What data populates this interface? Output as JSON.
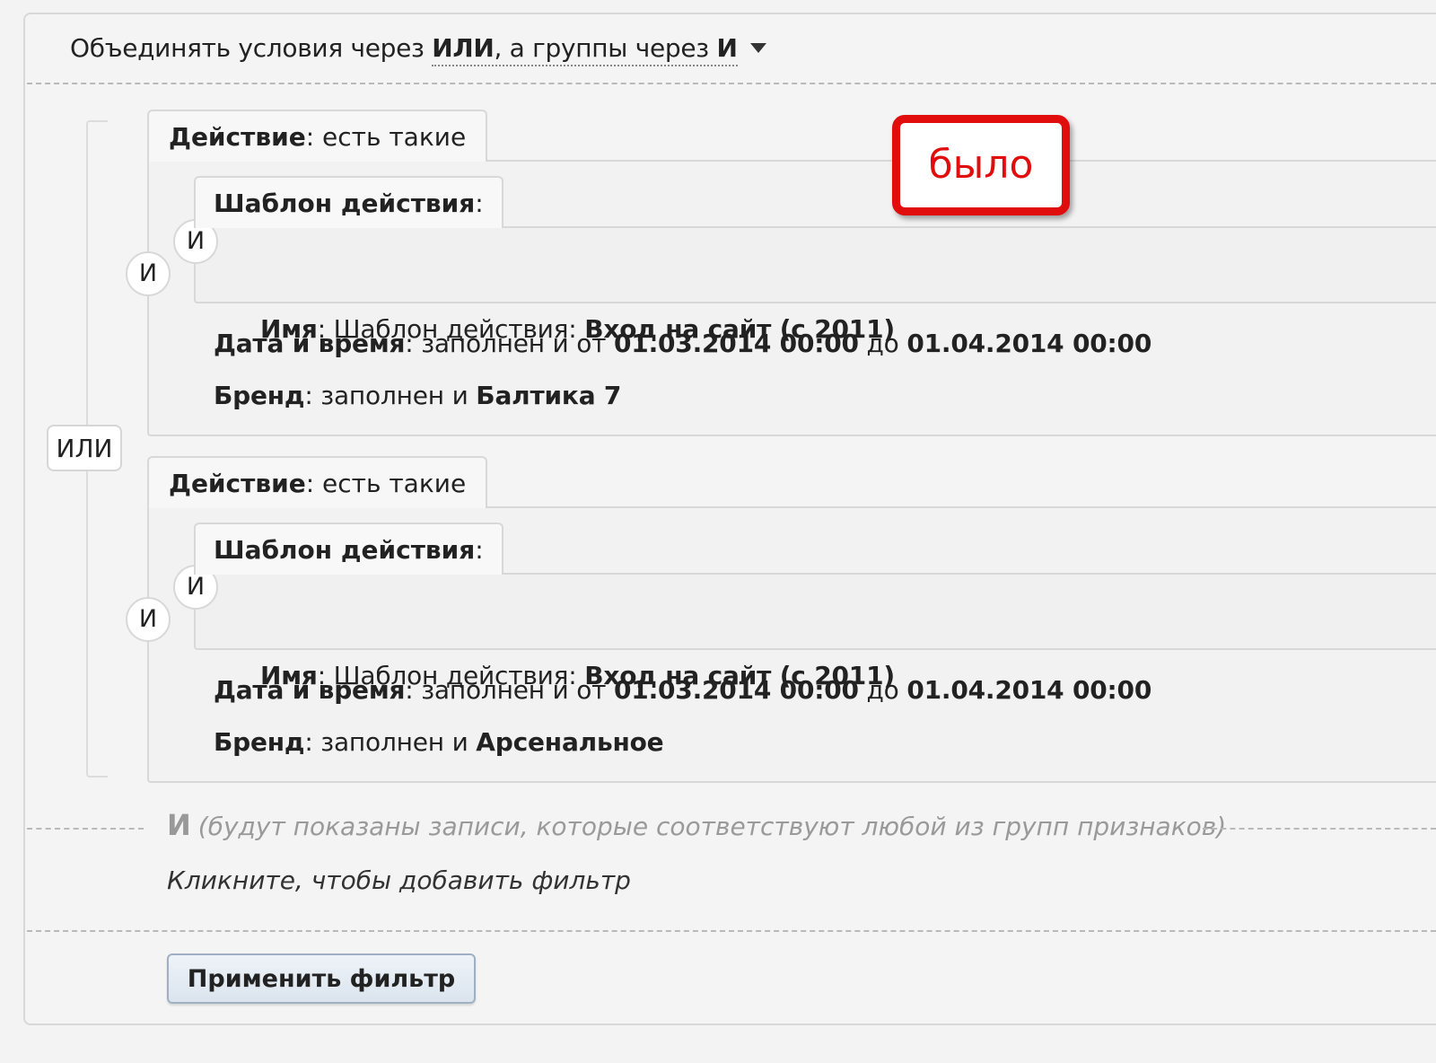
{
  "header": {
    "prefix": "Объединять условия через ",
    "conditions_op": "ИЛИ",
    "middle": ", а группы через ",
    "groups_op": "И",
    "dropdown_icon": "caret-down-icon"
  },
  "connectors": {
    "outer_or": "ИЛИ",
    "and": "И"
  },
  "groups": [
    {
      "action_label": "Действие",
      "action_value": ": есть такие",
      "template_label": "Шаблон действия",
      "template_colon": ":",
      "name_label": "Имя",
      "name_middle": ": Шаблон действия: ",
      "name_value": "Вход на сайт (с 2011)",
      "datetime_label": "Дата и время",
      "datetime_middle": ": заполнен и от ",
      "datetime_from": "01.03.2014 00:00",
      "datetime_to_word": " до ",
      "datetime_to": "01.04.2014 00:00",
      "brand_label": "Бренд",
      "brand_middle": ": заполнен и ",
      "brand_value": "Балтика 7"
    },
    {
      "action_label": "Действие",
      "action_value": ": есть такие",
      "template_label": "Шаблон действия",
      "template_colon": ":",
      "name_label": "Имя",
      "name_middle": ": Шаблон действия: ",
      "name_value": "Вход на сайт (с 2011)",
      "datetime_label": "Дата и время",
      "datetime_middle": ": заполнен и от ",
      "datetime_from": "01.03.2014 00:00",
      "datetime_to_word": " до ",
      "datetime_to": "01.04.2014 00:00",
      "brand_label": "Бренд",
      "brand_middle": ": заполнен и ",
      "brand_value": "Арсенальное"
    }
  ],
  "stamp": {
    "text": "было",
    "color": "#e10c0c"
  },
  "footer": {
    "and_label": "И",
    "and_note": "(будут показаны записи, которые соответствуют любой из групп признаков)",
    "add_filter": "Кликните, чтобы добавить фильтр",
    "apply_button": "Применить фильтр"
  }
}
